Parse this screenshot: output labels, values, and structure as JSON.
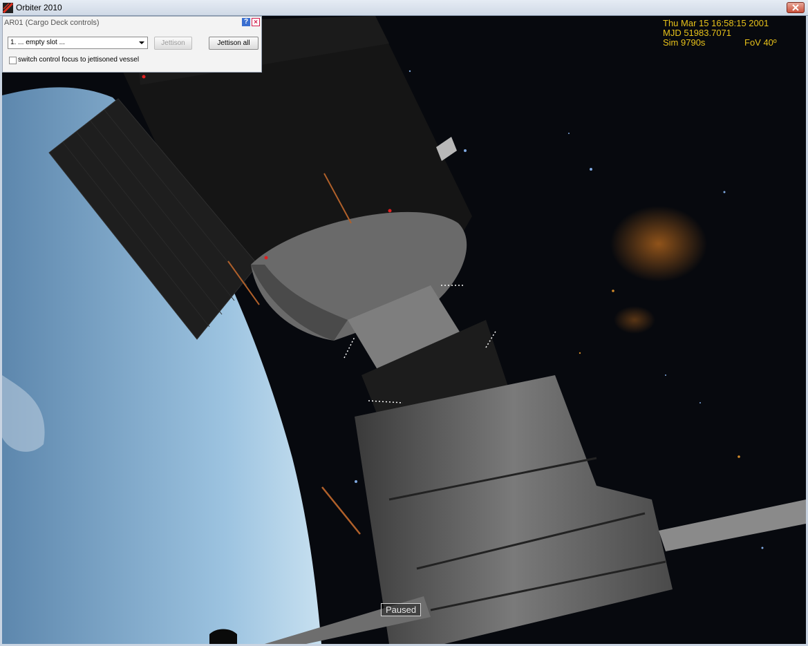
{
  "window": {
    "title": "Orbiter 2010",
    "close_label": "✕"
  },
  "dialog": {
    "title": "AR01 (Cargo Deck controls)",
    "help_label": "?",
    "close_label": "×",
    "slot_select_value": "1. ... empty slot ...",
    "jettison_label": "Jettison",
    "jettison_all_label": "Jettison all",
    "focus_checkbox_label": "switch control focus to jettisoned vessel",
    "focus_checkbox_checked": false
  },
  "hud": {
    "date": "Thu Mar 15 16:58:15 2001",
    "mjd": "MJD 51983.7071",
    "sim": "Sim  9790s",
    "fov": "FoV  40º"
  },
  "status": {
    "paused": "Paused"
  },
  "colors": {
    "hud_text": "#e8c21a",
    "earth_atmosphere": "#9cc3e0",
    "space": "#05070b"
  }
}
